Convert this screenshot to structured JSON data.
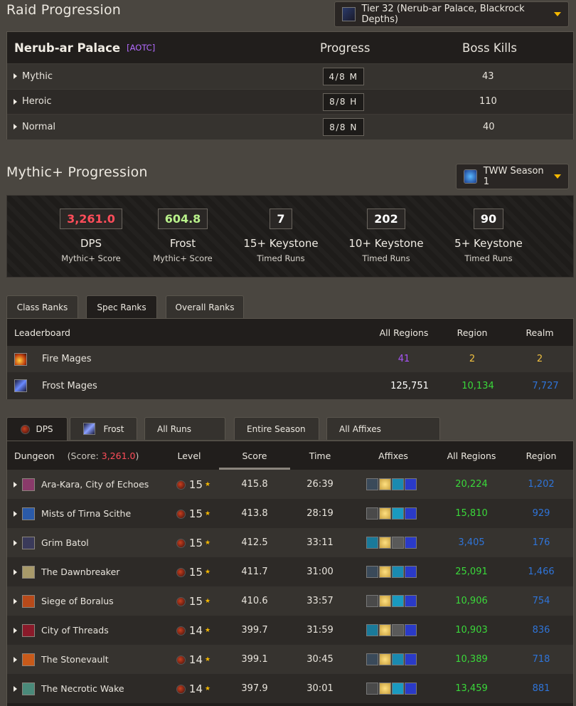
{
  "raid": {
    "title": "Raid Progression",
    "tier_selector": "Tier 32 (Nerub-ar Palace, Blackrock Depths)",
    "name": "Nerub-ar Palace",
    "badge": "[AOTC]",
    "col_progress": "Progress",
    "col_kills": "Boss Kills",
    "rows": [
      {
        "difficulty": "Mythic",
        "progress": "4/8 M",
        "kills": "43"
      },
      {
        "difficulty": "Heroic",
        "progress": "8/8 H",
        "kills": "110"
      },
      {
        "difficulty": "Normal",
        "progress": "8/8 N",
        "kills": "40"
      }
    ]
  },
  "mplus": {
    "title": "Mythic+ Progression",
    "season_selector": "TWW Season 1",
    "stats": [
      {
        "value": "3,261.0",
        "big": "DPS",
        "small": "Mythic+ Score",
        "color": "#ff4d5a"
      },
      {
        "value": "604.8",
        "big": "Frost",
        "small": "Mythic+ Score",
        "color": "#b8f08a"
      },
      {
        "value": "7",
        "big": "15+ Keystone",
        "small": "Timed Runs",
        "color": "#ffffff"
      },
      {
        "value": "202",
        "big": "10+ Keystone",
        "small": "Timed Runs",
        "color": "#ffffff"
      },
      {
        "value": "90",
        "big": "5+ Keystone",
        "small": "Timed Runs",
        "color": "#ffffff"
      }
    ]
  },
  "ranks": {
    "tabs": [
      "Class Ranks",
      "Spec Ranks",
      "Overall Ranks"
    ],
    "active_tab": 1,
    "header": {
      "leaderboard": "Leaderboard",
      "all_regions": "All Regions",
      "region": "Region",
      "realm": "Realm"
    },
    "rows": [
      {
        "name": "Fire Mages",
        "all_regions": "41",
        "region": "2",
        "realm": "2",
        "icon": "fire-mage-icon"
      },
      {
        "name": "Frost Mages",
        "all_regions": "125,751",
        "region": "10,134",
        "realm": "7,727",
        "icon": "frost-mage-icon"
      }
    ]
  },
  "runs": {
    "tabs": [
      "DPS",
      "Frost",
      "All Runs",
      "Entire Season",
      "All Affixes"
    ],
    "header": {
      "dungeon": "Dungeon",
      "score_label": "(Score: ",
      "score_value": "3,261.0",
      "score_close": ")",
      "level": "Level",
      "score": "Score",
      "time": "Time",
      "affixes": "Affixes",
      "all_regions": "All Regions",
      "region": "Region"
    },
    "rows": [
      {
        "dungeon": "Ara-Kara, City of Echoes",
        "level": "15",
        "score": "415.8",
        "time": "26:39",
        "all_regions": "20,224",
        "region": "1,202",
        "ar_color": "#3ad83a",
        "rg_color": "#2f74d8",
        "icon_color": "#8a3a6a"
      },
      {
        "dungeon": "Mists of Tirna Scithe",
        "level": "15",
        "score": "413.8",
        "time": "28:19",
        "all_regions": "15,810",
        "region": "929",
        "ar_color": "#3ad83a",
        "rg_color": "#2f74d8",
        "icon_color": "#2a5aa8"
      },
      {
        "dungeon": "Grim Batol",
        "level": "15",
        "score": "412.5",
        "time": "33:11",
        "all_regions": "3,405",
        "region": "176",
        "ar_color": "#2f74d8",
        "rg_color": "#2f74d8",
        "icon_color": "#3a3a5a"
      },
      {
        "dungeon": "The Dawnbreaker",
        "level": "15",
        "score": "411.7",
        "time": "31:00",
        "all_regions": "25,091",
        "region": "1,466",
        "ar_color": "#3ad83a",
        "rg_color": "#2f74d8",
        "icon_color": "#a89a6a"
      },
      {
        "dungeon": "Siege of Boralus",
        "level": "15",
        "score": "410.6",
        "time": "33:57",
        "all_regions": "10,906",
        "region": "754",
        "ar_color": "#3ad83a",
        "rg_color": "#2f74d8",
        "icon_color": "#b84a1a"
      },
      {
        "dungeon": "City of Threads",
        "level": "14",
        "score": "399.7",
        "time": "31:59",
        "all_regions": "10,903",
        "region": "836",
        "ar_color": "#3ad83a",
        "rg_color": "#2f74d8",
        "icon_color": "#8a1a2a"
      },
      {
        "dungeon": "The Stonevault",
        "level": "14",
        "score": "399.1",
        "time": "30:45",
        "all_regions": "10,389",
        "region": "718",
        "ar_color": "#3ad83a",
        "rg_color": "#2f74d8",
        "icon_color": "#c85a1a"
      },
      {
        "dungeon": "The Necrotic Wake",
        "level": "14",
        "score": "397.9",
        "time": "30:01",
        "all_regions": "13,459",
        "region": "881",
        "ar_color": "#3ad83a",
        "rg_color": "#2f74d8",
        "icon_color": "#4a8a7a"
      }
    ]
  }
}
